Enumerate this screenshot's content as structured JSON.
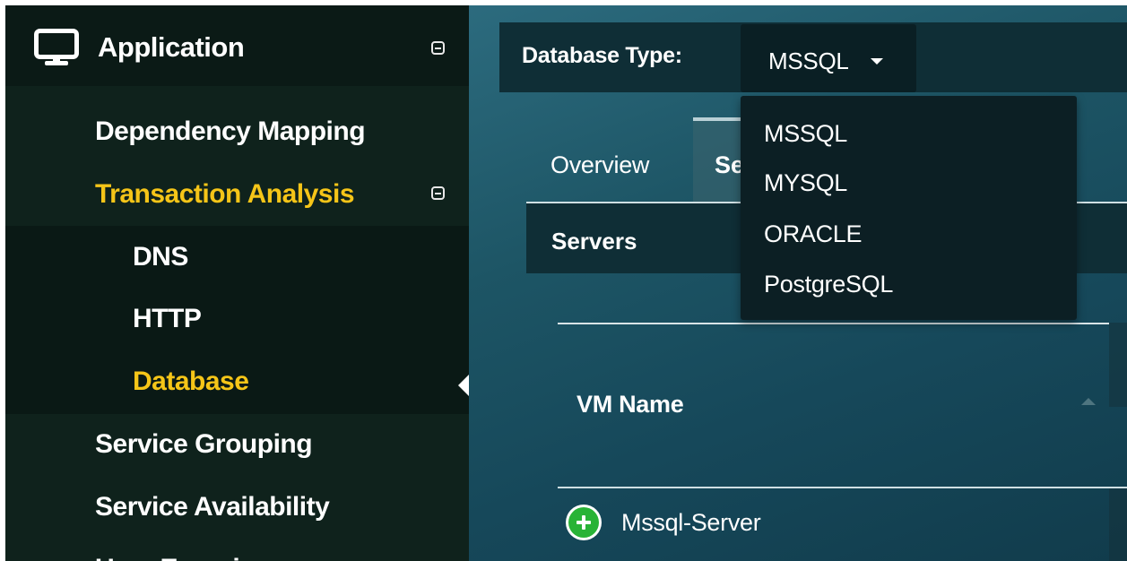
{
  "sidebar": {
    "section_title": "Application",
    "items": [
      {
        "label": "Dependency Mapping"
      },
      {
        "label": "Transaction Analysis"
      },
      {
        "label": "DNS"
      },
      {
        "label": "HTTP"
      },
      {
        "label": "Database"
      },
      {
        "label": "Service Grouping"
      },
      {
        "label": "Service Availability"
      },
      {
        "label": "User Experience"
      }
    ],
    "active_item": "Database",
    "colors": {
      "active": "#f5c518",
      "normal": "#ffffff"
    }
  },
  "header": {
    "db_type_label": "Database Type:",
    "db_type_selected": "MSSQL"
  },
  "dropdown": {
    "options": [
      "MSSQL",
      "MYSQL",
      "ORACLE",
      "PostgreSQL"
    ]
  },
  "tabs": [
    {
      "label": "Overview"
    },
    {
      "label": "Servers",
      "selected": true
    }
  ],
  "servers_panel": {
    "title": "Servers",
    "table": {
      "columns": [
        "VM Name"
      ],
      "rows": [
        {
          "vm_name": "Mssql-Server"
        }
      ]
    }
  },
  "icons": {
    "app": "monitor-icon",
    "collapse": "collapse-icon",
    "caret": "caret-down-icon",
    "expand_row": "plus-circle-icon"
  }
}
